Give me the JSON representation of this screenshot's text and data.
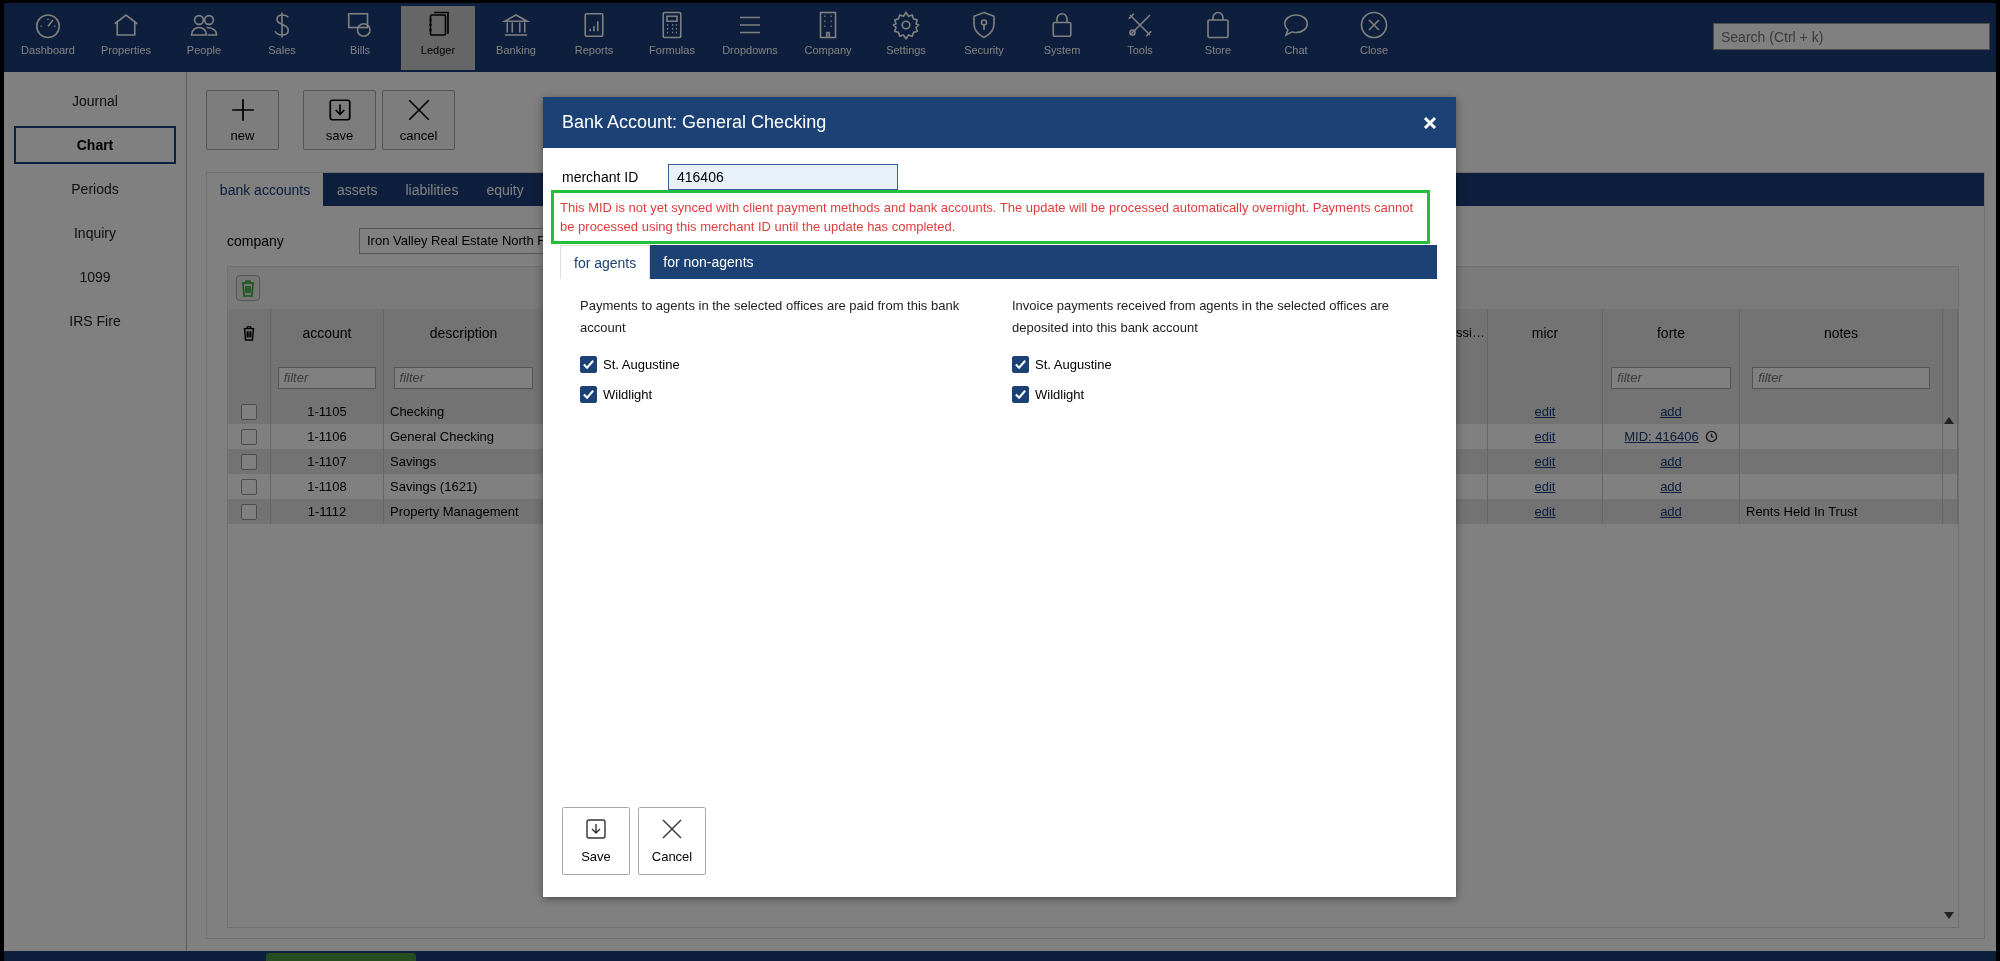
{
  "nav": {
    "items": [
      {
        "label": "Dashboard",
        "selected": false
      },
      {
        "label": "Properties",
        "selected": false
      },
      {
        "label": "People",
        "selected": false
      },
      {
        "label": "Sales",
        "selected": false
      },
      {
        "label": "Bills",
        "selected": false
      },
      {
        "label": "Ledger",
        "selected": true
      },
      {
        "label": "Banking",
        "selected": false
      },
      {
        "label": "Reports",
        "selected": false
      },
      {
        "label": "Formulas",
        "selected": false
      },
      {
        "label": "Dropdowns",
        "selected": false
      },
      {
        "label": "Company",
        "selected": false
      },
      {
        "label": "Settings",
        "selected": false
      },
      {
        "label": "Security",
        "selected": false
      },
      {
        "label": "System",
        "selected": false
      },
      {
        "label": "Tools",
        "selected": false
      },
      {
        "label": "Store",
        "selected": false
      },
      {
        "label": "Chat",
        "selected": false
      },
      {
        "label": "Close",
        "selected": false
      }
    ],
    "search": {
      "placeholder": "Search (Ctrl + k)"
    }
  },
  "sidebar": {
    "items": [
      {
        "label": "Journal",
        "selected": false
      },
      {
        "label": "Chart",
        "selected": true
      },
      {
        "label": "Periods",
        "selected": false
      },
      {
        "label": "Inquiry",
        "selected": false
      },
      {
        "label": "1099",
        "selected": false
      },
      {
        "label": "IRS Fire",
        "selected": false
      }
    ]
  },
  "toolbar": {
    "buttons": [
      {
        "label": "new"
      },
      {
        "label": "save"
      },
      {
        "label": "cancel"
      }
    ]
  },
  "tabs": [
    {
      "label": "bank accounts",
      "selected": true
    },
    {
      "label": "assets",
      "selected": false
    },
    {
      "label": "liabilities",
      "selected": false
    },
    {
      "label": "equity",
      "selected": false
    }
  ],
  "company": {
    "label": "company",
    "value": "Iron Valley Real Estate North F"
  },
  "table": {
    "columns": [
      {
        "label": "account",
        "filter": {
          "placeholder": "filter"
        }
      },
      {
        "label": "description",
        "filter": {
          "placeholder": "filter"
        }
      },
      {
        "label": "ssi…"
      },
      {
        "label": "micr"
      },
      {
        "label": "forte",
        "filter": {
          "placeholder": "filter"
        }
      },
      {
        "label": "notes",
        "filter": {
          "placeholder": "filter"
        }
      }
    ],
    "rows": [
      {
        "selected": false,
        "account": "1-1105",
        "description": "Checking",
        "micr": "edit",
        "forte": "add",
        "forte_pending": false
      },
      {
        "selected": false,
        "account": "1-1106",
        "description": "General Checking",
        "micr": "edit",
        "forte": "MID: 416406",
        "forte_pending": true
      },
      {
        "selected": false,
        "account": "1-1107",
        "description": "Savings",
        "micr": "edit",
        "forte": "add",
        "forte_pending": false
      },
      {
        "selected": false,
        "account": "1-1108",
        "description": "Savings (1621)",
        "micr": "edit",
        "forte": "add",
        "forte_pending": false
      },
      {
        "selected": false,
        "account": "1-1112",
        "description": "Property Management",
        "micr": "edit",
        "forte": "add",
        "forte_pending": false,
        "notes": "Rents Held In Trust"
      }
    ]
  },
  "modal": {
    "title": "Bank Account: General Checking",
    "merchant_id": {
      "label": "merchant ID",
      "value": "416406"
    },
    "warning": "This MID is not yet synced with client payment methods and bank accounts. The update will be processed automatically overnight. Payments cannot be processed using this merchant ID until the update has completed.",
    "tabs": [
      {
        "label": "for agents",
        "selected": true
      },
      {
        "label": "for non-agents",
        "selected": false
      }
    ],
    "sections": [
      {
        "text": "Payments to agents in the selected offices are paid from this bank account",
        "offices": [
          {
            "label": "St. Augustine",
            "checked": true
          },
          {
            "label": "Wildlight",
            "checked": true
          }
        ]
      },
      {
        "text": "Invoice payments received from agents in the selected offices are deposited into this bank account",
        "offices": [
          {
            "label": "St. Augustine",
            "checked": true
          },
          {
            "label": "Wildlight",
            "checked": true
          }
        ]
      }
    ],
    "buttons": [
      {
        "label": "Save"
      },
      {
        "label": "Cancel"
      }
    ]
  }
}
